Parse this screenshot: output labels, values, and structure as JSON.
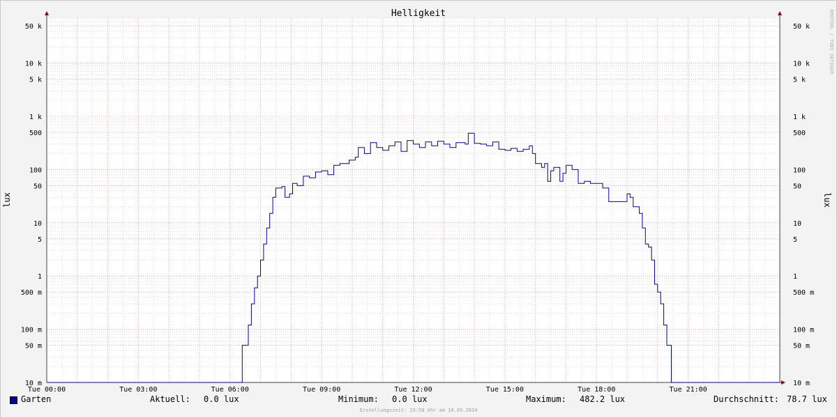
{
  "chart_data": {
    "type": "line",
    "title": "Helligkeit",
    "ylabel": "lux",
    "watermark": "RRDTOOL / TOBI OETIKER",
    "y_scale": "log",
    "ylim_lux": [
      0.01,
      70000
    ],
    "xlim_hours": [
      0,
      24
    ],
    "x_ticks": [
      {
        "h": 0,
        "label": "Tue 00:00"
      },
      {
        "h": 3,
        "label": "Tue 03:00"
      },
      {
        "h": 6,
        "label": "Tue 06:00"
      },
      {
        "h": 9,
        "label": "Tue 09:00"
      },
      {
        "h": 12,
        "label": "Tue 12:00"
      },
      {
        "h": 15,
        "label": "Tue 15:00"
      },
      {
        "h": 18,
        "label": "Tue 18:00"
      },
      {
        "h": 21,
        "label": "Tue 21:00"
      }
    ],
    "y_ticks": [
      {
        "v": 0.01,
        "label": "10 m"
      },
      {
        "v": 0.05,
        "label": "50 m"
      },
      {
        "v": 0.1,
        "label": "100 m"
      },
      {
        "v": 0.5,
        "label": "500 m"
      },
      {
        "v": 1,
        "label": "1"
      },
      {
        "v": 5,
        "label": "5"
      },
      {
        "v": 10,
        "label": "10"
      },
      {
        "v": 50,
        "label": "50"
      },
      {
        "v": 100,
        "label": "100"
      },
      {
        "v": 500,
        "label": "500"
      },
      {
        "v": 1000,
        "label": "1 k"
      },
      {
        "v": 5000,
        "label": "5 k"
      },
      {
        "v": 10000,
        "label": "10 k"
      },
      {
        "v": 50000,
        "label": "50 k"
      }
    ],
    "series": [
      {
        "name": "Garten",
        "color": "#0000a0",
        "points_hours_lux": [
          [
            0,
            0.01
          ],
          [
            6.4,
            0.01
          ],
          [
            6.4,
            0.05
          ],
          [
            6.55,
            0.05
          ],
          [
            6.6,
            0.12
          ],
          [
            6.7,
            0.3
          ],
          [
            6.8,
            0.6
          ],
          [
            6.9,
            1.0
          ],
          [
            7.0,
            2.0
          ],
          [
            7.1,
            4.0
          ],
          [
            7.2,
            8.0
          ],
          [
            7.3,
            15.0
          ],
          [
            7.4,
            30.0
          ],
          [
            7.5,
            45.0
          ],
          [
            7.7,
            48.0
          ],
          [
            7.8,
            30.0
          ],
          [
            7.95,
            35.0
          ],
          [
            8.05,
            55.0
          ],
          [
            8.2,
            50.0
          ],
          [
            8.4,
            75.0
          ],
          [
            8.6,
            70.0
          ],
          [
            8.8,
            90.0
          ],
          [
            9.0,
            95.0
          ],
          [
            9.2,
            80.0
          ],
          [
            9.4,
            120.0
          ],
          [
            9.6,
            130.0
          ],
          [
            9.9,
            150.0
          ],
          [
            10.1,
            170.0
          ],
          [
            10.2,
            260.0
          ],
          [
            10.4,
            200.0
          ],
          [
            10.6,
            320.0
          ],
          [
            10.8,
            260.0
          ],
          [
            11.0,
            230.0
          ],
          [
            11.2,
            280.0
          ],
          [
            11.4,
            330.0
          ],
          [
            11.6,
            220.0
          ],
          [
            11.8,
            350.0
          ],
          [
            12.0,
            300.0
          ],
          [
            12.2,
            260.0
          ],
          [
            12.4,
            330.0
          ],
          [
            12.6,
            280.0
          ],
          [
            12.8,
            340.0
          ],
          [
            13.0,
            300.0
          ],
          [
            13.2,
            260.0
          ],
          [
            13.4,
            320.0
          ],
          [
            13.7,
            300.0
          ],
          [
            13.8,
            482.2
          ],
          [
            14.0,
            310.0
          ],
          [
            14.2,
            300.0
          ],
          [
            14.4,
            280.0
          ],
          [
            14.6,
            330.0
          ],
          [
            14.8,
            240.0
          ],
          [
            15.0,
            230.0
          ],
          [
            15.2,
            250.0
          ],
          [
            15.4,
            220.0
          ],
          [
            15.6,
            240.0
          ],
          [
            15.8,
            280.0
          ],
          [
            15.9,
            200.0
          ],
          [
            16.0,
            130.0
          ],
          [
            16.2,
            110.0
          ],
          [
            16.3,
            130.0
          ],
          [
            16.4,
            60.0
          ],
          [
            16.5,
            95.0
          ],
          [
            16.6,
            110.0
          ],
          [
            16.8,
            60.0
          ],
          [
            16.9,
            85.0
          ],
          [
            17.0,
            120.0
          ],
          [
            17.2,
            100.0
          ],
          [
            17.4,
            55.0
          ],
          [
            17.6,
            60.0
          ],
          [
            17.8,
            55.0
          ],
          [
            18.0,
            55.0
          ],
          [
            18.2,
            45.0
          ],
          [
            18.4,
            25.0
          ],
          [
            18.6,
            25.0
          ],
          [
            18.8,
            25.0
          ],
          [
            19.0,
            35.0
          ],
          [
            19.1,
            30.0
          ],
          [
            19.2,
            20.0
          ],
          [
            19.4,
            15.0
          ],
          [
            19.5,
            8.0
          ],
          [
            19.6,
            4.0
          ],
          [
            19.7,
            3.5
          ],
          [
            19.8,
            2.0
          ],
          [
            19.9,
            0.7
          ],
          [
            20.0,
            0.5
          ],
          [
            20.1,
            0.3
          ],
          [
            20.2,
            0.12
          ],
          [
            20.3,
            0.05
          ],
          [
            20.45,
            0.05
          ],
          [
            20.45,
            0.01
          ],
          [
            24,
            0.01
          ]
        ]
      }
    ],
    "legend": {
      "name": "Garten",
      "current_label": "Aktuell:",
      "current_value": "0.0 lux",
      "min_label": "Minimum:",
      "min_value": "0.0 lux",
      "max_label": "Maximum:",
      "max_value": "482.2 lux",
      "avg_label": "Durchschnitt:",
      "avg_value": "78.7 lux"
    },
    "footer": "Erstellungszeit: 23:58 Uhr am 10.09.2024"
  }
}
